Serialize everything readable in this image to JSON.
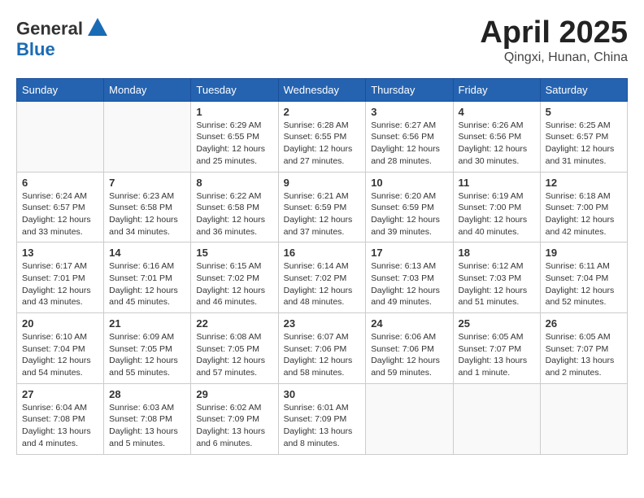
{
  "header": {
    "logo_line1": "General",
    "logo_line2": "Blue",
    "month_title": "April 2025",
    "location": "Qingxi, Hunan, China"
  },
  "days_of_week": [
    "Sunday",
    "Monday",
    "Tuesday",
    "Wednesday",
    "Thursday",
    "Friday",
    "Saturday"
  ],
  "weeks": [
    [
      {
        "day": "",
        "detail": ""
      },
      {
        "day": "",
        "detail": ""
      },
      {
        "day": "1",
        "detail": "Sunrise: 6:29 AM\nSunset: 6:55 PM\nDaylight: 12 hours\nand 25 minutes."
      },
      {
        "day": "2",
        "detail": "Sunrise: 6:28 AM\nSunset: 6:55 PM\nDaylight: 12 hours\nand 27 minutes."
      },
      {
        "day": "3",
        "detail": "Sunrise: 6:27 AM\nSunset: 6:56 PM\nDaylight: 12 hours\nand 28 minutes."
      },
      {
        "day": "4",
        "detail": "Sunrise: 6:26 AM\nSunset: 6:56 PM\nDaylight: 12 hours\nand 30 minutes."
      },
      {
        "day": "5",
        "detail": "Sunrise: 6:25 AM\nSunset: 6:57 PM\nDaylight: 12 hours\nand 31 minutes."
      }
    ],
    [
      {
        "day": "6",
        "detail": "Sunrise: 6:24 AM\nSunset: 6:57 PM\nDaylight: 12 hours\nand 33 minutes."
      },
      {
        "day": "7",
        "detail": "Sunrise: 6:23 AM\nSunset: 6:58 PM\nDaylight: 12 hours\nand 34 minutes."
      },
      {
        "day": "8",
        "detail": "Sunrise: 6:22 AM\nSunset: 6:58 PM\nDaylight: 12 hours\nand 36 minutes."
      },
      {
        "day": "9",
        "detail": "Sunrise: 6:21 AM\nSunset: 6:59 PM\nDaylight: 12 hours\nand 37 minutes."
      },
      {
        "day": "10",
        "detail": "Sunrise: 6:20 AM\nSunset: 6:59 PM\nDaylight: 12 hours\nand 39 minutes."
      },
      {
        "day": "11",
        "detail": "Sunrise: 6:19 AM\nSunset: 7:00 PM\nDaylight: 12 hours\nand 40 minutes."
      },
      {
        "day": "12",
        "detail": "Sunrise: 6:18 AM\nSunset: 7:00 PM\nDaylight: 12 hours\nand 42 minutes."
      }
    ],
    [
      {
        "day": "13",
        "detail": "Sunrise: 6:17 AM\nSunset: 7:01 PM\nDaylight: 12 hours\nand 43 minutes."
      },
      {
        "day": "14",
        "detail": "Sunrise: 6:16 AM\nSunset: 7:01 PM\nDaylight: 12 hours\nand 45 minutes."
      },
      {
        "day": "15",
        "detail": "Sunrise: 6:15 AM\nSunset: 7:02 PM\nDaylight: 12 hours\nand 46 minutes."
      },
      {
        "day": "16",
        "detail": "Sunrise: 6:14 AM\nSunset: 7:02 PM\nDaylight: 12 hours\nand 48 minutes."
      },
      {
        "day": "17",
        "detail": "Sunrise: 6:13 AM\nSunset: 7:03 PM\nDaylight: 12 hours\nand 49 minutes."
      },
      {
        "day": "18",
        "detail": "Sunrise: 6:12 AM\nSunset: 7:03 PM\nDaylight: 12 hours\nand 51 minutes."
      },
      {
        "day": "19",
        "detail": "Sunrise: 6:11 AM\nSunset: 7:04 PM\nDaylight: 12 hours\nand 52 minutes."
      }
    ],
    [
      {
        "day": "20",
        "detail": "Sunrise: 6:10 AM\nSunset: 7:04 PM\nDaylight: 12 hours\nand 54 minutes."
      },
      {
        "day": "21",
        "detail": "Sunrise: 6:09 AM\nSunset: 7:05 PM\nDaylight: 12 hours\nand 55 minutes."
      },
      {
        "day": "22",
        "detail": "Sunrise: 6:08 AM\nSunset: 7:05 PM\nDaylight: 12 hours\nand 57 minutes."
      },
      {
        "day": "23",
        "detail": "Sunrise: 6:07 AM\nSunset: 7:06 PM\nDaylight: 12 hours\nand 58 minutes."
      },
      {
        "day": "24",
        "detail": "Sunrise: 6:06 AM\nSunset: 7:06 PM\nDaylight: 12 hours\nand 59 minutes."
      },
      {
        "day": "25",
        "detail": "Sunrise: 6:05 AM\nSunset: 7:07 PM\nDaylight: 13 hours\nand 1 minute."
      },
      {
        "day": "26",
        "detail": "Sunrise: 6:05 AM\nSunset: 7:07 PM\nDaylight: 13 hours\nand 2 minutes."
      }
    ],
    [
      {
        "day": "27",
        "detail": "Sunrise: 6:04 AM\nSunset: 7:08 PM\nDaylight: 13 hours\nand 4 minutes."
      },
      {
        "day": "28",
        "detail": "Sunrise: 6:03 AM\nSunset: 7:08 PM\nDaylight: 13 hours\nand 5 minutes."
      },
      {
        "day": "29",
        "detail": "Sunrise: 6:02 AM\nSunset: 7:09 PM\nDaylight: 13 hours\nand 6 minutes."
      },
      {
        "day": "30",
        "detail": "Sunrise: 6:01 AM\nSunset: 7:09 PM\nDaylight: 13 hours\nand 8 minutes."
      },
      {
        "day": "",
        "detail": ""
      },
      {
        "day": "",
        "detail": ""
      },
      {
        "day": "",
        "detail": ""
      }
    ]
  ]
}
